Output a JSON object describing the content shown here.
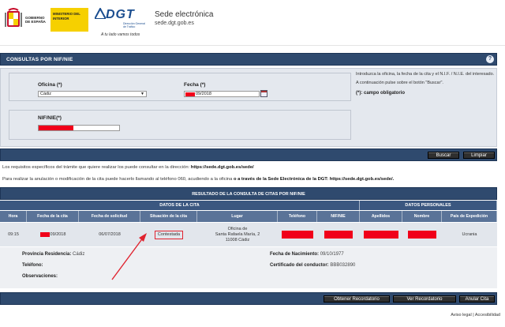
{
  "header": {
    "gov_line1": "GOBIERNO DE ESPAÑA",
    "gov_line2": "MINISTERIO DEL INTERIOR",
    "dgt_word": "DGT",
    "dgt_sub": "Dirección General de Tráfico",
    "dgt_slogan": "A tu lado vamos todos",
    "sede_title": "Sede electrónica",
    "sede_url": "sede.dgt.gob.es"
  },
  "title_bar": {
    "title": "CONSULTAS POR NIF/NIE",
    "help_icon": "question-icon"
  },
  "form": {
    "oficina_label": "Oficina (*)",
    "oficina_value": "Cádiz",
    "fecha_label": "Fecha (*)",
    "fecha_value": "09/2018",
    "nif_label": "NIF/NIE(*)",
    "help1": "Introduzca la oficina, la fecha de la cita y el N.I.F. / N.I.E. del interesado.",
    "help2": "A continuación pulse sobre el botón \"Buscar\".",
    "required_note": "(*): campo obligatorio"
  },
  "buttons": {
    "buscar": "Buscar",
    "limpiar": "Limpiar"
  },
  "info": {
    "line1_text": "Los requisitos específicos del trámite que quiere realizar los puede consultar en la dirección: ",
    "line1_link": "https://sede.dgt.gob.es/sede/",
    "line2_text": "Para realizar la anulación o modificación de la cita puede hacerlo llamando al teléfono 060, acudiendo a la oficina ",
    "line2_bold": "o a través de la Sede Electrónica de la DGT: https://sede.dgt.gob.es/sede/."
  },
  "results": {
    "title": "RESULTADO DE LA CONSULTA DE CITAS POR NIF/NIE",
    "group_cita": "DATOS DE LA CITA",
    "group_personal": "DATOS PERSONALES",
    "columns": [
      "Hora",
      "Fecha de la cita",
      "Fecha de solicitud",
      "Situación de la cita",
      "Lugar",
      "Teléfono",
      "NIF/NIE",
      "Apellidos",
      "Nombre",
      "País de Expedición"
    ],
    "row": {
      "hora": "09:15",
      "fecha_cita": "09/2018",
      "fecha_solicitud": "06/07/2018",
      "situacion": "Contestada",
      "lugar1": "Oficina de",
      "lugar2": "Santa Rafaela María, 2",
      "lugar3": "11008 Cádiz",
      "pais": "Ucrania"
    }
  },
  "details": {
    "provincia_label": "Provincia Residencia:",
    "provincia_value": "Cádiz",
    "telefono_label": "Teléfono:",
    "observaciones_label": "Observaciones:",
    "nacimiento_label": "Fecha de Nacimiento:",
    "nacimiento_value": "09/10/1977",
    "certificado_label": "Certificado del conductor:",
    "certificado_value": "BBB032890"
  },
  "actions": {
    "obtener": "Obtener Recordatorio",
    "ver": "Ver Recordatorio",
    "anular": "Anular Cita"
  },
  "footer": {
    "aviso": "Aviso legal",
    "sep": "|",
    "accesibilidad": "Accesibilidad"
  },
  "colors": {
    "navy": "#2f4a6e",
    "redact": "#f0001a",
    "highlight": "#e0232f"
  }
}
